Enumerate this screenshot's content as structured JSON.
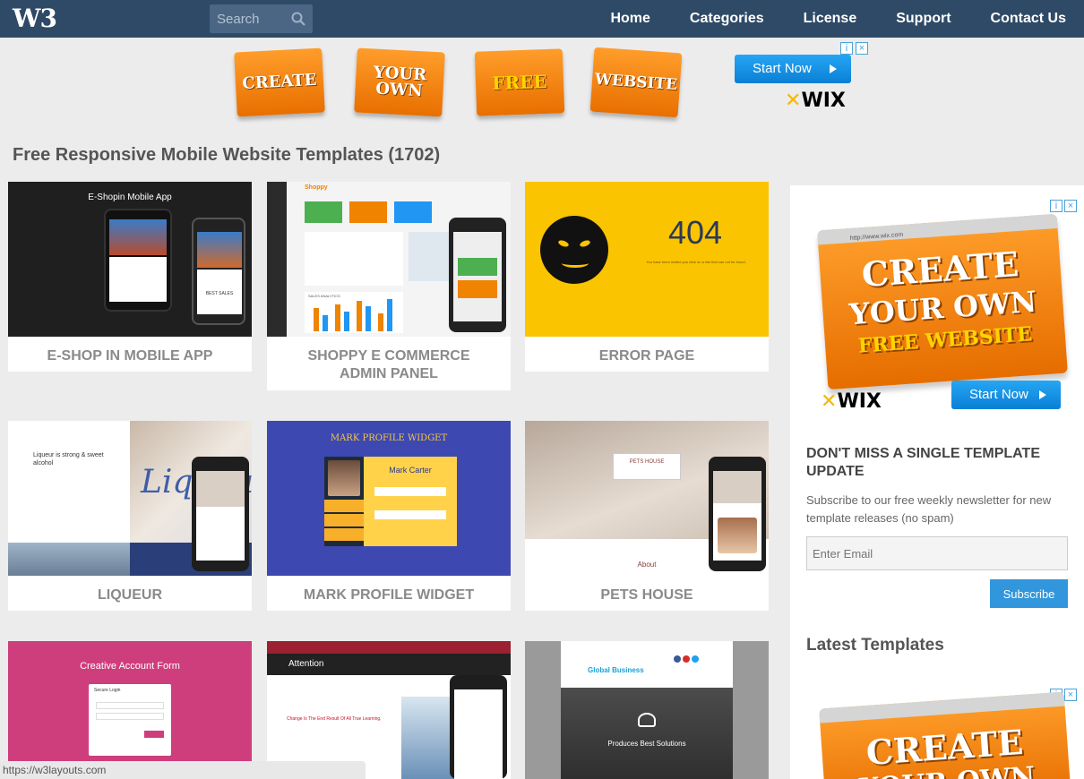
{
  "header": {
    "logo": "W3",
    "search_placeholder": "Search",
    "nav": [
      "Home",
      "Categories",
      "License",
      "Support",
      "Contact Us"
    ]
  },
  "top_ad": {
    "tiles": [
      "CREATE",
      "YOUR OWN",
      "FREE",
      "WEBSITE"
    ],
    "start_label": "Start Now",
    "brand": "WIX"
  },
  "page_title": "Free Responsive Mobile Website Templates (1702)",
  "cards": [
    {
      "title": "E-SHOP IN MOBILE APP",
      "thumb_heading": "E-Shopin Mobile App",
      "thumb_sub": "BEST SALES"
    },
    {
      "title": "SHOPPY E COMMERCE ADMIN PANEL",
      "thumb_heading": "Shoppy",
      "thumb_sub": "SALES ANALYTICS"
    },
    {
      "title": "ERROR PAGE",
      "thumb_heading": "404",
      "thumb_sub": "You have been invited you click on a link that can not be found."
    },
    {
      "title": "LIQUEUR",
      "thumb_heading": "Liqueur is strong & sweet alcohol",
      "thumb_sub": "Liqueur"
    },
    {
      "title": "MARK PROFILE WIDGET",
      "thumb_heading": "MARK PROFILE WIDGET",
      "thumb_sub": "Mark Carter"
    },
    {
      "title": "PETS HOUSE",
      "thumb_heading": "PETS HOUSE",
      "thumb_sub": "About"
    },
    {
      "title": "",
      "thumb_heading": "Creative Account Form",
      "thumb_sub": "Secure Login"
    },
    {
      "title": "",
      "thumb_heading": "Attention",
      "thumb_sub": "Change Is The End Result Of All True Learning."
    },
    {
      "title": "",
      "thumb_heading": "Global Business",
      "thumb_sub": "Produces Best Solutions"
    }
  ],
  "sidebar": {
    "ad_lines": [
      "CREATE",
      "YOUR OWN",
      "FREE WEBSITE"
    ],
    "ad_url": "http://www.wix.com",
    "ad_start_label": "Start Now",
    "ad_brand": "WIX",
    "newsletter_heading": "DON'T MISS A SINGLE TEMPLATE UPDATE",
    "newsletter_text": "Subscribe to our free weekly newsletter for new template releases (no spam)",
    "email_placeholder": "Enter Email",
    "subscribe_label": "Subscribe",
    "latest_heading": "Latest Templates",
    "ad2_lines": [
      "CREATE",
      "YOUR OWN"
    ]
  },
  "status_url": "https://w3layouts.com",
  "colors": {
    "nav_bg": "#2e4a66",
    "accent_orange": "#f08300",
    "subscribe_blue": "#3296dc"
  }
}
